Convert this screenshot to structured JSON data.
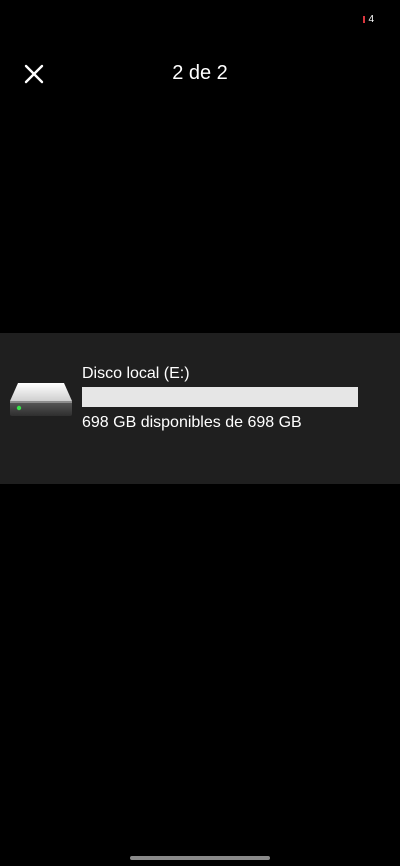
{
  "status": {
    "indicator_text": "4"
  },
  "header": {
    "title": "2 de 2",
    "close_icon": "close-icon"
  },
  "drive": {
    "name": "Disco local (E:)",
    "space_text": "698 GB disponibles de 698 GB",
    "used_fraction": 0.0,
    "icon": "hard-drive-icon"
  },
  "colors": {
    "background": "#000000",
    "panel": "#1f1f1f",
    "bar_track": "#e6e6e6",
    "bar_fill": "#26a0da",
    "status_dot": "#d9363e"
  }
}
